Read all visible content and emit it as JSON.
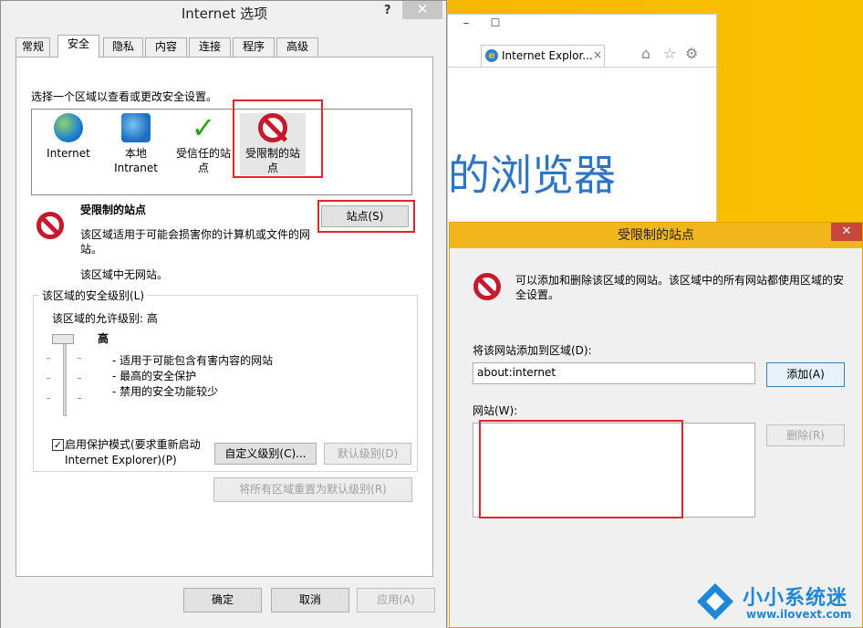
{
  "browser": {
    "tab_title": "Internet Explor...",
    "tab_close": "×",
    "minimize": "–",
    "maximize": "☐",
    "big_text": "的浏览器"
  },
  "options_dialog": {
    "title": "Internet 选项",
    "help": "?",
    "close": "✕",
    "tabs": [
      "常规",
      "安全",
      "隐私",
      "内容",
      "连接",
      "程序",
      "高级"
    ],
    "active_tab": "安全",
    "zone_prompt": "选择一个区域以查看或更改安全设置。",
    "zones": [
      {
        "label": "Internet",
        "icon": "globe-icon"
      },
      {
        "label": "本地\nIntranet",
        "icon": "intranet-icon"
      },
      {
        "label": "受信任的站\n点",
        "icon": "checkmark-icon"
      },
      {
        "label": "受限制的站\n点",
        "icon": "no-entry-icon"
      }
    ],
    "selected_zone_title": "受限制的站点",
    "selected_zone_desc": "该区域适用于可能会损害你的计算机或文件的网站。",
    "selected_zone_none": "该区域中无网站。",
    "sites_button": "站点(S)",
    "security_level_group": "该区域的安全级别(L)",
    "allowed_levels": "该区域的允许级别: 高",
    "level": "高",
    "level_bullets": [
      "- 适用于可能包含有害内容的网站",
      "- 最高的安全保护",
      "- 禁用的安全功能较少"
    ],
    "protected_mode_checked": true,
    "protected_mode_label": "启用保护模式(要求重新启动\nInternet Explorer)(P)",
    "custom_level_button": "自定义级别(C)...",
    "default_level_button": "默认级别(D)",
    "reset_all_button": "将所有区域重置为默认级别(R)",
    "ok_button": "确定",
    "cancel_button": "取消",
    "apply_button": "应用(A)"
  },
  "restricted_dialog": {
    "title": "受限制的站点",
    "close": "✕",
    "description": "可以添加和删除该区域的网站。该区域中的所有网站都使用区域的安全设置。",
    "add_label": "将该网站添加到区域(D):",
    "add_input_value": "about:internet",
    "add_button": "添加(A)",
    "websites_label": "网站(W):",
    "remove_button": "删除(R)"
  },
  "watermark": {
    "name": "小小系统迷",
    "url": "www.ilovext.com"
  },
  "colors": {
    "accent_red": "#e0262b",
    "title_yellow": "#f2b61d",
    "ie_blue": "#2e76c3"
  }
}
